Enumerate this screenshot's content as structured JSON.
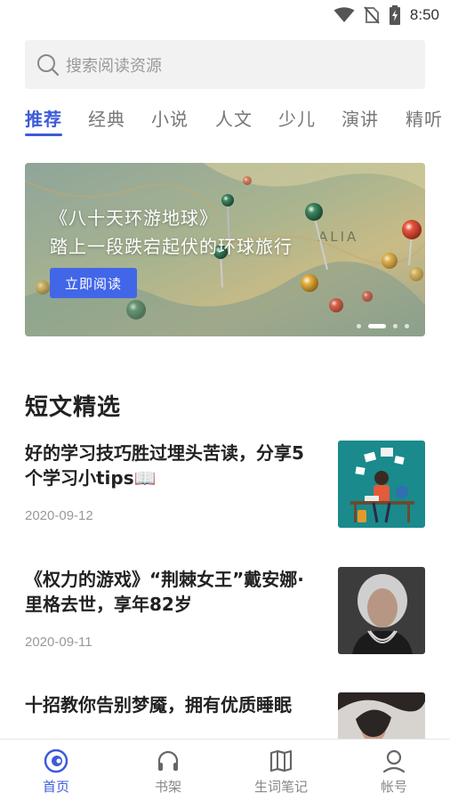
{
  "status_bar": {
    "time": "8:50"
  },
  "search": {
    "placeholder": "搜索阅读资源"
  },
  "tabs": [
    {
      "label": "推荐",
      "active": true
    },
    {
      "label": "经典"
    },
    {
      "label": "小说"
    },
    {
      "label": "人文"
    },
    {
      "label": "少儿"
    },
    {
      "label": "演讲"
    },
    {
      "label": "精听"
    }
  ],
  "banner": {
    "title": "《八十天环游地球》",
    "subtitle": "踏上一段跌宕起伏的环球旅行",
    "button_label": "立即阅读",
    "map_text": "ALIA",
    "slide_count": 4,
    "active_slide": 2
  },
  "section": {
    "title": "短文精选"
  },
  "articles": [
    {
      "title": "好的学习技巧胜过埋头苦读，分享5个学习小tips📖",
      "date": "2020-09-12"
    },
    {
      "title": "《权力的游戏》“荆棘女王”戴安娜·里格去世，享年82岁",
      "date": "2020-09-11"
    },
    {
      "title": "十招教你告别梦魇，拥有优质睡眠",
      "date": ""
    }
  ],
  "bottom_nav": [
    {
      "label": "首页",
      "icon": "home-icon",
      "active": true
    },
    {
      "label": "书架",
      "icon": "headphones-icon"
    },
    {
      "label": "生词笔记",
      "icon": "book-icon"
    },
    {
      "label": "帐号",
      "icon": "user-icon"
    }
  ],
  "colors": {
    "accent": "#3d5bd9",
    "button": "#4266e8"
  }
}
